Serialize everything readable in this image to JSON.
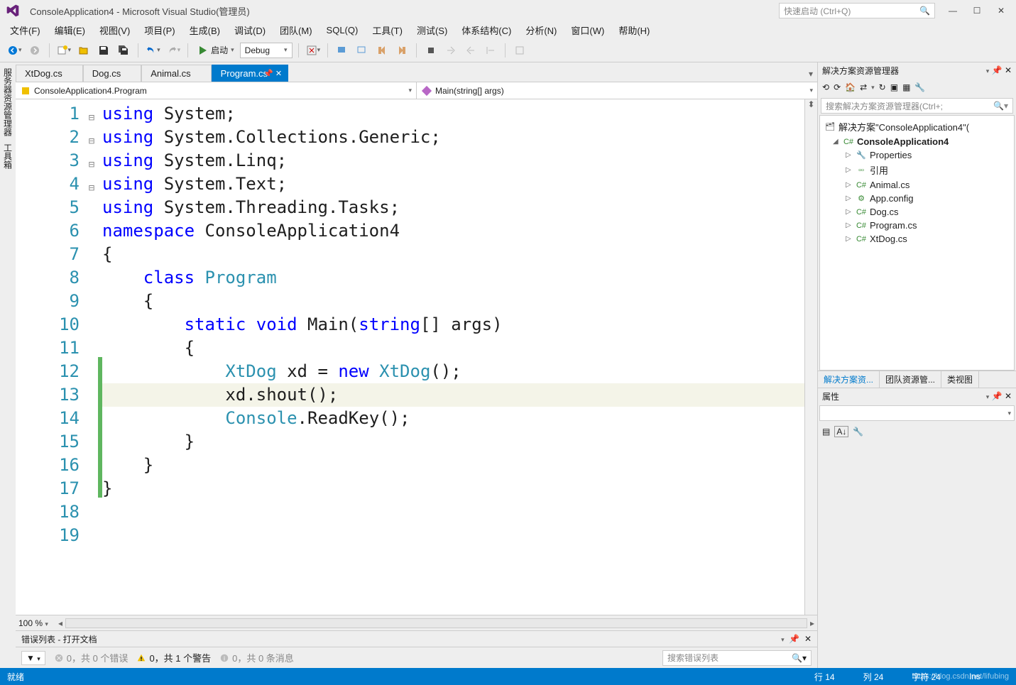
{
  "title": "ConsoleApplication4 - Microsoft Visual Studio(管理员)",
  "quick_launch": {
    "placeholder": "快速启动 (Ctrl+Q)"
  },
  "menu": [
    "文件(F)",
    "编辑(E)",
    "视图(V)",
    "项目(P)",
    "生成(B)",
    "调试(D)",
    "团队(M)",
    "SQL(Q)",
    "工具(T)",
    "测试(S)",
    "体系结构(C)",
    "分析(N)",
    "窗口(W)",
    "帮助(H)"
  ],
  "toolbar": {
    "start_label": "启动",
    "config": "Debug"
  },
  "tabs": [
    {
      "label": "XtDog.cs",
      "active": false
    },
    {
      "label": "Dog.cs",
      "active": false
    },
    {
      "label": "Animal.cs",
      "active": false
    },
    {
      "label": "Program.cs",
      "active": true
    }
  ],
  "nav": {
    "left": "ConsoleApplication4.Program",
    "right": "Main(string[] args)"
  },
  "left_rail": [
    "服务器资源管理器",
    "工具箱"
  ],
  "code": {
    "lines": [
      {
        "n": 1,
        "fold": "⊟",
        "html": "<span class='kw'>using</span> System;"
      },
      {
        "n": 2,
        "html": "<span class='kw'>using</span> System.Collections.Generic;"
      },
      {
        "n": 3,
        "html": "<span class='kw'>using</span> System.Linq;"
      },
      {
        "n": 4,
        "html": "<span class='kw'>using</span> System.Text;"
      },
      {
        "n": 5,
        "html": "<span class='kw'>using</span> System.Threading.Tasks;"
      },
      {
        "n": 6,
        "html": ""
      },
      {
        "n": 7,
        "fold": "⊟",
        "html": "<span class='kw'>namespace</span> ConsoleApplication4"
      },
      {
        "n": 8,
        "html": "{"
      },
      {
        "n": 9,
        "fold": "⊟",
        "html": "    <span class='kw'>class</span> <span class='ty'>Program</span>"
      },
      {
        "n": 10,
        "html": "    {"
      },
      {
        "n": 11,
        "fold": "⊟",
        "html": "        <span class='kw'>static</span> <span class='kw'>void</span> Main(<span class='kw'>string</span>[] args)"
      },
      {
        "n": 12,
        "mark": "g",
        "html": "        {"
      },
      {
        "n": 13,
        "mark": "g",
        "html": "            <span class='ty'>XtDog</span> xd = <span class='kw'>new</span> <span class='ty'>XtDog</span>();"
      },
      {
        "n": 14,
        "mark": "g",
        "hl": true,
        "html": "            xd.shout();"
      },
      {
        "n": 15,
        "mark": "g",
        "html": ""
      },
      {
        "n": 16,
        "mark": "g",
        "html": "            <span class='ty'>Console</span>.ReadKey();"
      },
      {
        "n": 17,
        "mark": "g",
        "html": "        }"
      },
      {
        "n": 18,
        "html": "    }"
      },
      {
        "n": 19,
        "html": "}"
      }
    ],
    "zoom": "100 %"
  },
  "error_panel": {
    "title": "错误列表 - 打开文档",
    "errors": "0，共 0 个错误",
    "warnings": "0，共 1 个警告",
    "messages": "0，共 0 条消息",
    "search_placeholder": "搜索错误列表"
  },
  "solution": {
    "title": "解决方案资源管理器",
    "search_placeholder": "搜索解决方案资源管理器(Ctrl+;",
    "root": "解决方案\"ConsoleApplication4\"(",
    "project": "ConsoleApplication4",
    "nodes": [
      "Properties",
      "引用",
      "Animal.cs",
      "App.config",
      "Dog.cs",
      "Program.cs",
      "XtDog.cs"
    ],
    "tabs": [
      "解决方案资...",
      "团队资源管...",
      "类视图"
    ]
  },
  "properties": {
    "title": "属性"
  },
  "status": {
    "ready": "就绪",
    "line": "行 14",
    "col": "列 24",
    "char": "字符 24",
    "ins": "Ins",
    "watermark": "https://blog.csdn.net/lifubing"
  }
}
